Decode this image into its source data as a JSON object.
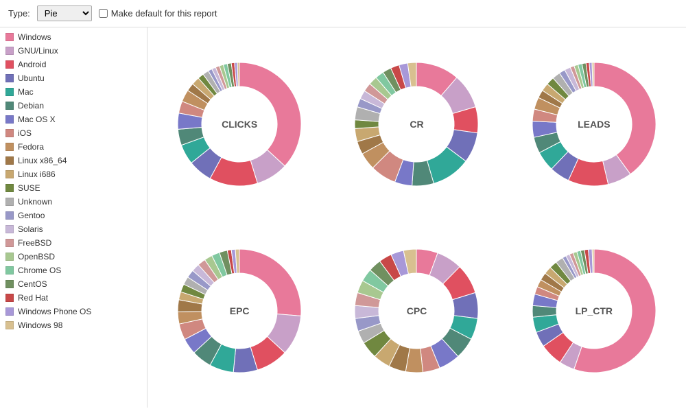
{
  "toolbar": {
    "type_label": "Type:",
    "type_options": [
      "Pie",
      "Bar",
      "Line"
    ],
    "type_selected": "Pie",
    "default_checkbox_label": "Make default for this report"
  },
  "legend": {
    "items": [
      {
        "label": "Windows",
        "color": "#e8799a"
      },
      {
        "label": "GNU/Linux",
        "color": "#c8a0c8"
      },
      {
        "label": "Android",
        "color": "#e05060"
      },
      {
        "label": "Ubuntu",
        "color": "#7070b8"
      },
      {
        "label": "Mac",
        "color": "#30a898"
      },
      {
        "label": "Debian",
        "color": "#508878"
      },
      {
        "label": "Mac OS X",
        "color": "#7878c8"
      },
      {
        "label": "iOS",
        "color": "#d08880"
      },
      {
        "label": "Fedora",
        "color": "#c09060"
      },
      {
        "label": "Linux x86_64",
        "color": "#a07848"
      },
      {
        "label": "Linux i686",
        "color": "#c8a870"
      },
      {
        "label": "SUSE",
        "color": "#708840"
      },
      {
        "label": "Unknown",
        "color": "#b0b0b0"
      },
      {
        "label": "Gentoo",
        "color": "#9898c8"
      },
      {
        "label": "Solaris",
        "color": "#c8b8d8"
      },
      {
        "label": "FreeBSD",
        "color": "#d09898"
      },
      {
        "label": "OpenBSD",
        "color": "#a8c890"
      },
      {
        "label": "Chrome OS",
        "color": "#80c8a0"
      },
      {
        "label": "CentOS",
        "color": "#709060"
      },
      {
        "label": "Red Hat",
        "color": "#c84848"
      },
      {
        "label": "Windows Phone OS",
        "color": "#a898d8"
      },
      {
        "label": "Windows 98",
        "color": "#d8c090"
      }
    ]
  },
  "charts": [
    {
      "id": "clicks",
      "label": "CLICKS"
    },
    {
      "id": "cr",
      "label": "CR"
    },
    {
      "id": "leads",
      "label": "LEADS"
    },
    {
      "id": "epc",
      "label": "EPC"
    },
    {
      "id": "cpc",
      "label": "CPC"
    },
    {
      "id": "lp_ctr",
      "label": "LP_CTR"
    }
  ]
}
